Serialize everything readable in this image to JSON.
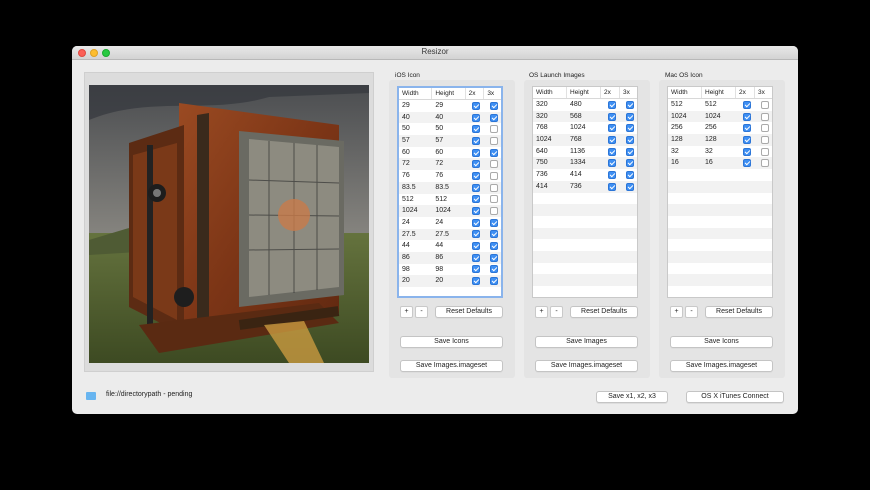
{
  "window": {
    "title": "Resizor"
  },
  "ios": {
    "label": "iOS Icon",
    "headers": [
      "Width",
      "Height",
      "2x",
      "3x"
    ],
    "rows": [
      {
        "w": "29",
        "h": "29",
        "x2": true,
        "x3": true
      },
      {
        "w": "40",
        "h": "40",
        "x2": true,
        "x3": true
      },
      {
        "w": "50",
        "h": "50",
        "x2": true,
        "x3": false
      },
      {
        "w": "57",
        "h": "57",
        "x2": true,
        "x3": false
      },
      {
        "w": "60",
        "h": "60",
        "x2": true,
        "x3": true
      },
      {
        "w": "72",
        "h": "72",
        "x2": true,
        "x3": false
      },
      {
        "w": "76",
        "h": "76",
        "x2": true,
        "x3": false
      },
      {
        "w": "83.5",
        "h": "83.5",
        "x2": true,
        "x3": false
      },
      {
        "w": "512",
        "h": "512",
        "x2": true,
        "x3": false
      },
      {
        "w": "1024",
        "h": "1024",
        "x2": true,
        "x3": false
      },
      {
        "w": "24",
        "h": "24",
        "x2": true,
        "x3": true
      },
      {
        "w": "27.5",
        "h": "27.5",
        "x2": true,
        "x3": true
      },
      {
        "w": "44",
        "h": "44",
        "x2": true,
        "x3": true
      },
      {
        "w": "86",
        "h": "86",
        "x2": true,
        "x3": true
      },
      {
        "w": "98",
        "h": "98",
        "x2": true,
        "x3": true
      },
      {
        "w": "20",
        "h": "20",
        "x2": true,
        "x3": true
      }
    ],
    "add_label": "+",
    "remove_label": "-",
    "reset_label": "Reset Defaults",
    "save_label": "Save Icons",
    "save_set_label": "Save Images.imageset"
  },
  "launch": {
    "label": "OS Launch Images",
    "headers": [
      "Width",
      "Height",
      "2x",
      "3x"
    ],
    "rows": [
      {
        "w": "320",
        "h": "480",
        "x2": true,
        "x3": true
      },
      {
        "w": "320",
        "h": "568",
        "x2": true,
        "x3": true
      },
      {
        "w": "768",
        "h": "1024",
        "x2": true,
        "x3": true
      },
      {
        "w": "1024",
        "h": "768",
        "x2": true,
        "x3": true
      },
      {
        "w": "640",
        "h": "1136",
        "x2": true,
        "x3": true
      },
      {
        "w": "750",
        "h": "1334",
        "x2": true,
        "x3": true
      },
      {
        "w": "736",
        "h": "414",
        "x2": true,
        "x3": true
      },
      {
        "w": "414",
        "h": "736",
        "x2": true,
        "x3": true
      }
    ],
    "add_label": "+",
    "remove_label": "-",
    "reset_label": "Reset Defaults",
    "save_label": "Save Images",
    "save_set_label": "Save Images.imageset"
  },
  "mac": {
    "label": "Mac OS Icon",
    "headers": [
      "Width",
      "Height",
      "2x",
      "3x"
    ],
    "rows": [
      {
        "w": "512",
        "h": "512",
        "x2": true,
        "x3": false
      },
      {
        "w": "1024",
        "h": "1024",
        "x2": true,
        "x3": false
      },
      {
        "w": "256",
        "h": "256",
        "x2": true,
        "x3": false
      },
      {
        "w": "128",
        "h": "128",
        "x2": true,
        "x3": false
      },
      {
        "w": "32",
        "h": "32",
        "x2": true,
        "x3": false
      },
      {
        "w": "16",
        "h": "16",
        "x2": true,
        "x3": false
      }
    ],
    "add_label": "+",
    "remove_label": "-",
    "reset_label": "Reset Defaults",
    "save_label": "Save Icons",
    "save_set_label": "Save Images.imageset"
  },
  "footer": {
    "path_text": "file://directorypath - pending",
    "save_all_label": "Save x1, x2, x3",
    "itunes_label": "OS X iTunes Connect"
  },
  "colors": {
    "accent": "#3e8ff3",
    "focus_ring": "#8ab4ec",
    "window_bg": "#ececec"
  }
}
